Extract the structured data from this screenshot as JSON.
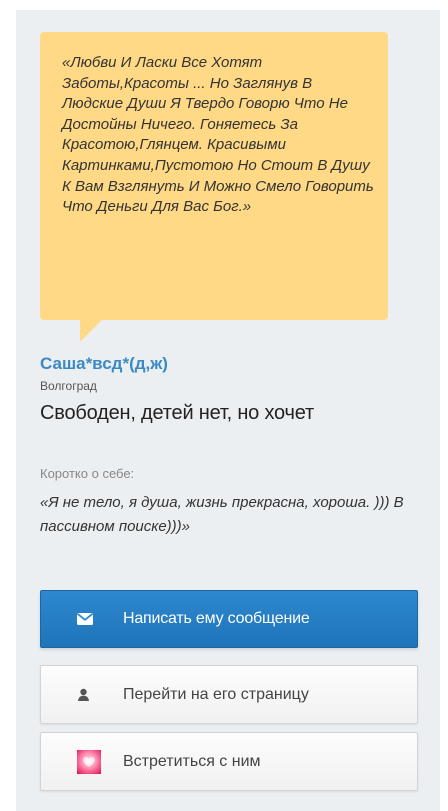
{
  "quote": {
    "text": "«Любви И Ласки Все Хотят Заботы,Красоты ... Но Заглянув В Людские Души Я Твердо Говорю Что Не Достойны Ничего. Гоняетесь За Красотою,Глянцем. Красивыми Картинками,Пустотою Но Стоит В Душу К Вам Взглянуть И Можно Смело Говорить Что Деньги Для Вас Бог.»"
  },
  "profile": {
    "name": "Саша*всд*(д,ж)",
    "city": "Волгоград",
    "status": "Свободен, детей нет, но хочет"
  },
  "about": {
    "label": "Коротко о себе:",
    "text": "«Я не тело, я душа, жизнь прекрасна, хороша. ))) В пассивном поиске)))»"
  },
  "actions": {
    "message_label": "Написать ему сообщение",
    "profile_label": "Перейти на его страницу",
    "meet_label": "Встретиться с ним"
  },
  "icons": {
    "message": "envelope-icon",
    "profile": "person-icon",
    "meet": "heart-icon"
  },
  "colors": {
    "quote_bg": "#ffd986",
    "name": "#3a8ac4",
    "primary_button": "#2d88cf",
    "panel_bg": "#eceff2"
  }
}
